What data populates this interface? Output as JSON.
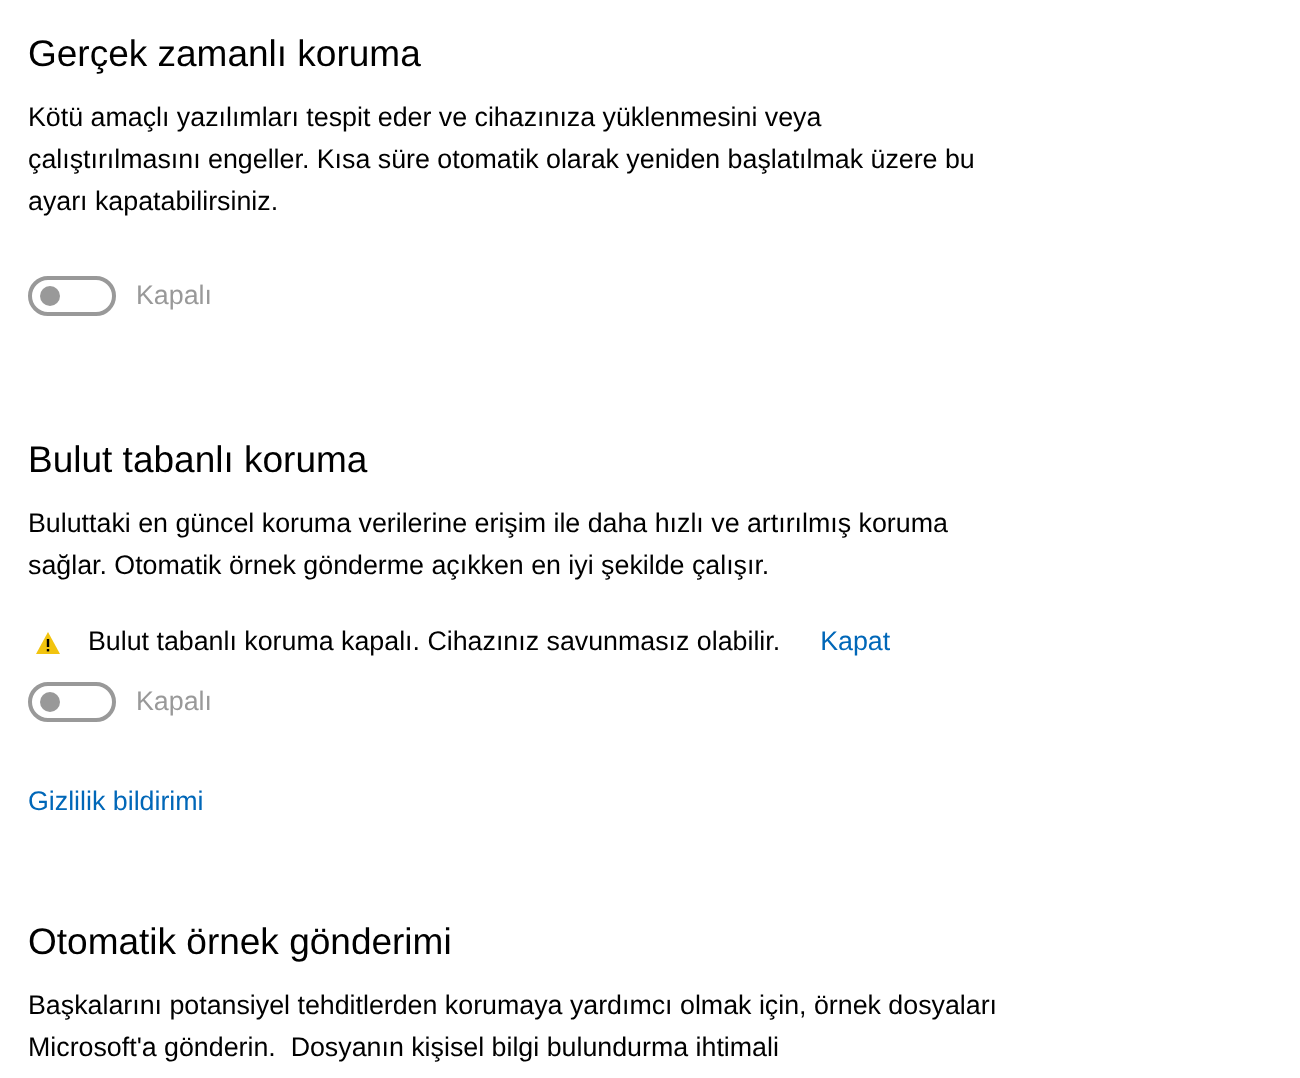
{
  "sections": [
    {
      "title": "Gerçek zamanlı koruma",
      "description": "Kötü amaçlı yazılımları tespit eder ve cihazınıza yüklenmesini veya çalıştırılmasını engeller. Kısa süre otomatik olarak yeniden başlatılmak üzere bu ayarı kapatabilirsiniz.",
      "toggle": {
        "label": "Kapalı",
        "on": false,
        "disabled": true
      }
    },
    {
      "title": "Bulut tabanlı koruma",
      "description": "Buluttaki en güncel koruma verilerine erişim ile daha hızlı ve artırılmış koruma sağlar. Otomatik örnek gönderme açıkken en iyi şekilde çalışır.",
      "warning": {
        "text": "Bulut tabanlı koruma kapalı. Cihazınız savunmasız olabilir.",
        "action": "Kapat"
      },
      "toggle": {
        "label": "Kapalı",
        "on": false,
        "disabled": true
      },
      "link": "Gizlilik bildirimi"
    },
    {
      "title": "Otomatik örnek gönderimi",
      "description": "Başkalarını potansiyel tehditlerden korumaya yardımcı olmak için, örnek dosyaları Microsoft'a gönderin.  Dosyanın kişisel bilgi bulundurma ihtimali"
    }
  ]
}
